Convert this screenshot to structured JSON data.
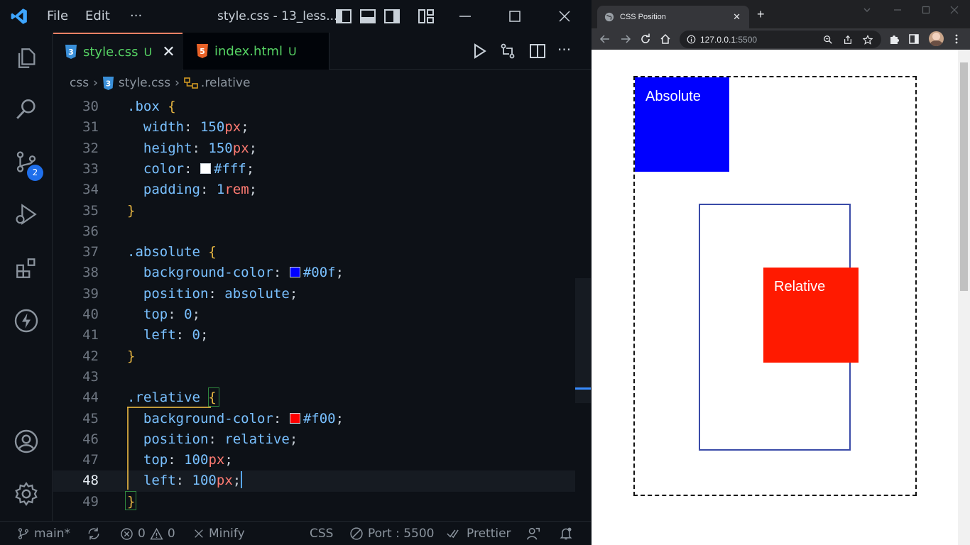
{
  "vscode": {
    "menu": [
      "File",
      "Edit",
      "···"
    ],
    "window_title": "style.css - 13_less...",
    "tabs": [
      {
        "name": "style.css",
        "status": "U",
        "active": true
      },
      {
        "name": "index.html",
        "status": "U",
        "active": false
      }
    ],
    "breadcrumb": [
      "css",
      "style.css",
      ".relative"
    ],
    "scm_badge": "2",
    "lines": [
      {
        "n": "30"
      },
      {
        "n": "31"
      },
      {
        "n": "32"
      },
      {
        "n": "33"
      },
      {
        "n": "34"
      },
      {
        "n": "35"
      },
      {
        "n": "36"
      },
      {
        "n": "37"
      },
      {
        "n": "38"
      },
      {
        "n": "39"
      },
      {
        "n": "40"
      },
      {
        "n": "41"
      },
      {
        "n": "42"
      },
      {
        "n": "43"
      },
      {
        "n": "44"
      },
      {
        "n": "45"
      },
      {
        "n": "46"
      },
      {
        "n": "47"
      },
      {
        "n": "48"
      },
      {
        "n": "49"
      }
    ],
    "code": {
      "l30": {
        "sel": ".box",
        "brace": "{"
      },
      "l31": {
        "prop": "width",
        "num": "150",
        "unit": "px"
      },
      "l32": {
        "prop": "height",
        "num": "150",
        "unit": "px"
      },
      "l33": {
        "prop": "color",
        "val": "#fff",
        "swatch": "#ffffff"
      },
      "l34": {
        "prop": "padding",
        "num": "1",
        "unit": "rem"
      },
      "l35": {
        "brace": "}"
      },
      "l37": {
        "sel": ".absolute",
        "brace": "{"
      },
      "l38": {
        "prop": "background-color",
        "val": "#00f",
        "swatch": "#0000ff"
      },
      "l39": {
        "prop": "position",
        "val": "absolute"
      },
      "l40": {
        "prop": "top",
        "num": "0"
      },
      "l41": {
        "prop": "left",
        "num": "0"
      },
      "l42": {
        "brace": "}"
      },
      "l44": {
        "sel": ".relative",
        "brace": "{"
      },
      "l45": {
        "prop": "background-color",
        "val": "#f00",
        "swatch": "#ff0000"
      },
      "l46": {
        "prop": "position",
        "val": "relative"
      },
      "l47": {
        "prop": "top",
        "num": "100",
        "unit": "px"
      },
      "l48": {
        "prop": "left",
        "num": "100",
        "unit": "px"
      },
      "l49": {
        "brace": "}"
      }
    },
    "status": {
      "branch": "main*",
      "errors": "0",
      "warnings": "0",
      "minify": "Minify",
      "language": "CSS",
      "port": "Port : 5500",
      "prettier": "Prettier"
    }
  },
  "browser": {
    "tab_title": "CSS Position",
    "url_host": "127.0.0.1",
    "url_port": ":5500",
    "page": {
      "absolute_label": "Absolute",
      "relative_label": "Relative"
    }
  },
  "colors": {
    "absolute_bg": "#0000ff",
    "relative_bg": "#ff1a00",
    "accent_tab": "#f78166",
    "untracked": "#56d364"
  }
}
